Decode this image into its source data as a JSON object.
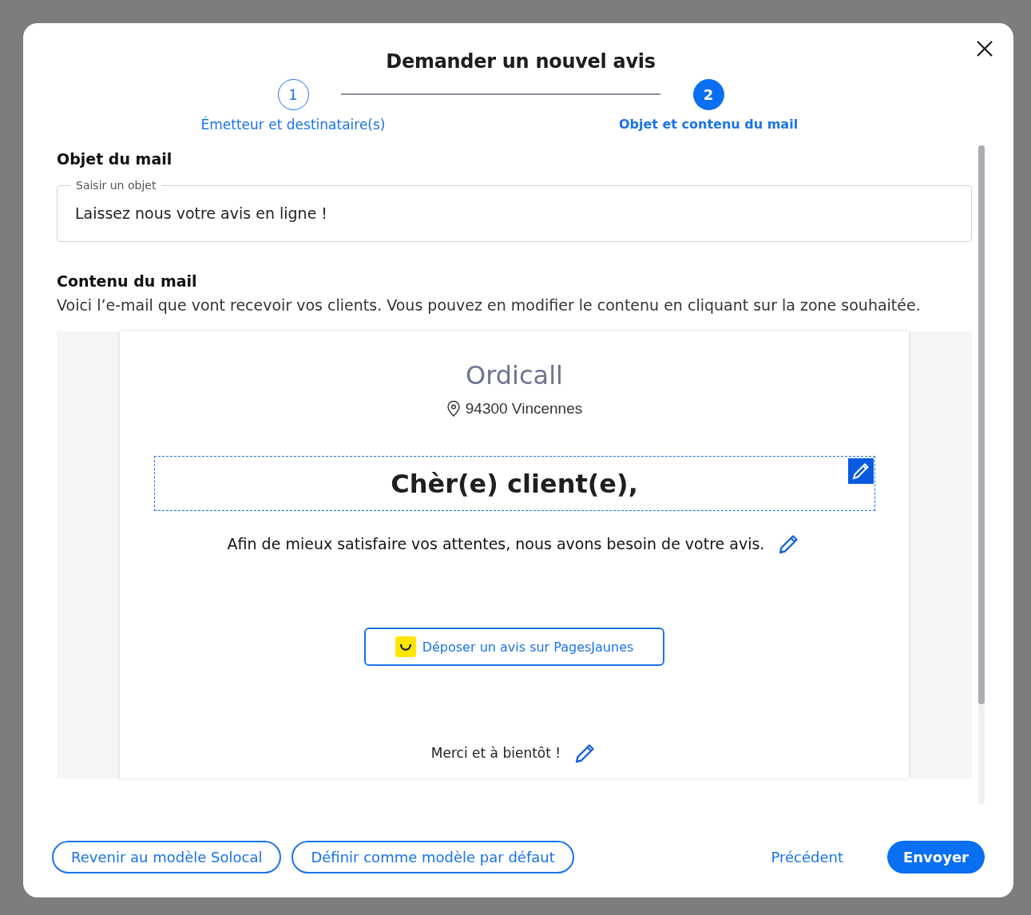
{
  "dialog": {
    "title": "Demander un nouvel avis"
  },
  "steps": [
    {
      "number": "1",
      "label": "Émetteur et destinataire(s)",
      "selected": false
    },
    {
      "number": "2",
      "label": "Objet et contenu du mail",
      "selected": true
    }
  ],
  "subject": {
    "heading": "Objet du mail",
    "label": "Saisir un objet",
    "value": "Laissez nous votre avis en ligne !"
  },
  "content": {
    "heading": "Contenu du mail",
    "description": "Voici l’e-mail que vont recevoir vos clients. Vous pouvez en modifier le contenu en cliquant sur la zone souhaitée."
  },
  "email": {
    "company": "Ordicall",
    "address": "94300 Vincennes",
    "blocks": [
      {
        "kind": "greeting",
        "text": "Chèr(e) client(e),",
        "selected": true
      },
      {
        "kind": "text",
        "text": "Afin de mieux satisfaire vos attentes, nous avons besoin de votre avis."
      },
      {
        "kind": "button",
        "text": "Déposer un avis sur PagesJaunes"
      },
      {
        "kind": "closing",
        "text": "Merci et à bientôt !"
      }
    ]
  },
  "footer": {
    "left_buttons": [
      "Revenir au modèle Solocal",
      "Définir comme modèle par défaut"
    ],
    "back": "Précédent",
    "send": "Envoyer"
  }
}
